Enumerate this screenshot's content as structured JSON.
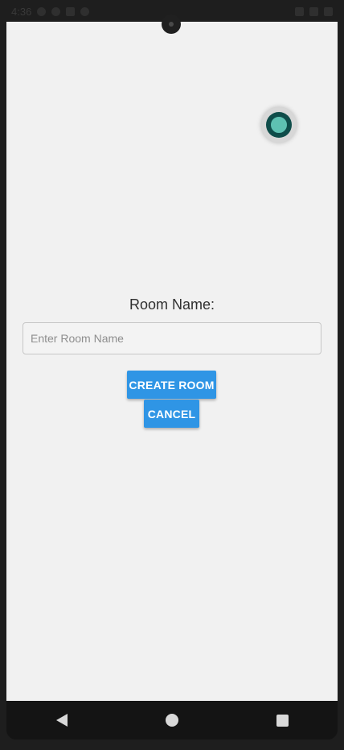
{
  "status_bar": {
    "time": "4:36",
    "icons": [
      "settings-icon",
      "at-icon",
      "storage-icon",
      "block-icon",
      "wifi-icon",
      "signal-icon",
      "battery-icon"
    ]
  },
  "form": {
    "room_label": "Room Name:",
    "room_input": {
      "placeholder": "Enter Room Name",
      "value": ""
    },
    "create_button": "CREATE ROOM",
    "cancel_button": "CANCEL"
  },
  "navigation": {
    "buttons": [
      "back-icon",
      "home-icon",
      "recent-apps-icon"
    ]
  },
  "colors": {
    "background": "#f1f1f1",
    "primary": "#2f95e5",
    "floating_control_fill": "#5ec1b2",
    "floating_control_ring": "#0f4d4a"
  }
}
